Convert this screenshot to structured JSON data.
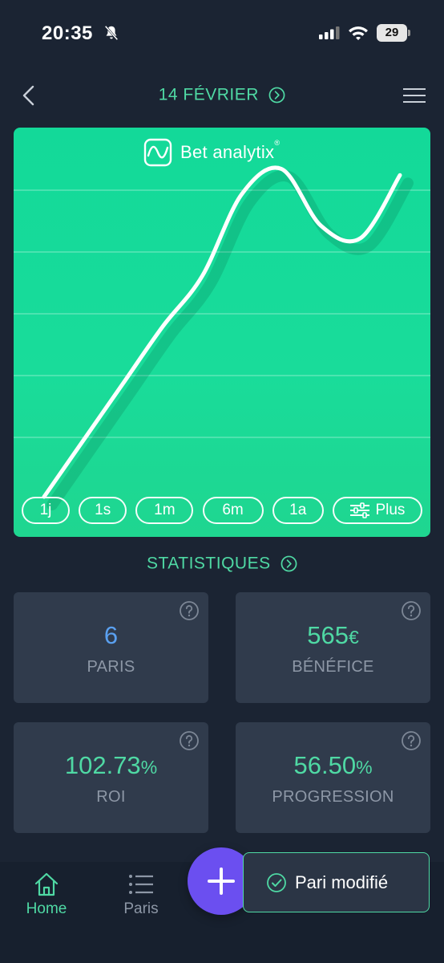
{
  "status_bar": {
    "time": "20:35",
    "battery": "29"
  },
  "header": {
    "date": "14 FÉVRIER"
  },
  "chart": {
    "brand": "Bet analytix",
    "brand_mark": "®",
    "periods": [
      "1j",
      "1s",
      "1m",
      "6m",
      "1a"
    ],
    "more_label": "Plus"
  },
  "chart_data": {
    "type": "line",
    "title": "",
    "xlabel": "",
    "ylabel": "",
    "grid": true,
    "series": [
      {
        "values": [
          0,
          45,
          90,
          135,
          175,
          240,
          260,
          215,
          205,
          255
        ]
      }
    ],
    "ylim": [
      0,
      280
    ]
  },
  "stats": {
    "title": "STATISTIQUES",
    "cards": [
      {
        "value": "6",
        "unit": "",
        "label": "PARIS",
        "color": "#5aa0f0"
      },
      {
        "value": "565",
        "unit": "€",
        "label": "BÉNÉFICE",
        "color": "#4fd9a4"
      },
      {
        "value": "102.73",
        "unit": "%",
        "label": "ROI",
        "color": "#4fd9a4"
      },
      {
        "value": "56.50",
        "unit": "%",
        "label": "PROGRESSION",
        "color": "#4fd9a4"
      }
    ]
  },
  "nav": {
    "home": "Home",
    "bets": "Paris"
  },
  "toast": {
    "text": "Pari modifié"
  },
  "colors": {
    "accent": "#4fd9a4",
    "fab": "#6b4ff0",
    "chart_bg": "#19dc9a"
  }
}
